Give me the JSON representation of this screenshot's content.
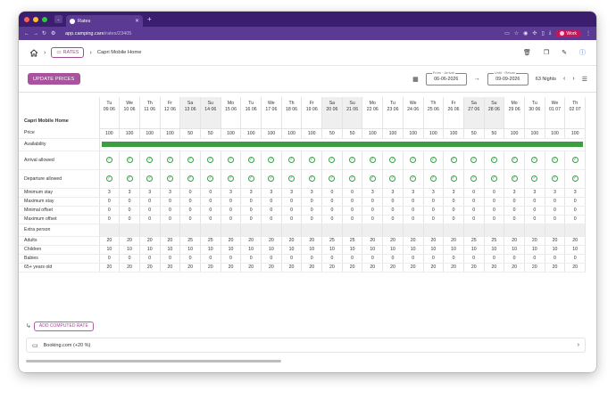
{
  "browser": {
    "tab_title": "Rates",
    "url_host": "app.camping.care",
    "url_path": "/rates/23405",
    "profile_label": "Work"
  },
  "header": {
    "rates_label": "RATES",
    "current": "Capri Mobile Home"
  },
  "toolbar": {
    "update_label": "UPDATE PRICES",
    "from_label": "From · Arrival",
    "from_value": "06-06-2026",
    "until_label": "Until · Return",
    "until_value": "09-09-2026",
    "nights": "63 Nights"
  },
  "grid": {
    "title": "Capri Mobile Home",
    "days": [
      {
        "wd": "Tu",
        "date": "09 06"
      },
      {
        "wd": "We",
        "date": "10 06"
      },
      {
        "wd": "Th",
        "date": "11 06"
      },
      {
        "wd": "Fr",
        "date": "12 06"
      },
      {
        "wd": "Sa",
        "date": "13 06"
      },
      {
        "wd": "Su",
        "date": "14 06"
      },
      {
        "wd": "Mo",
        "date": "15 06"
      },
      {
        "wd": "Tu",
        "date": "16 06"
      },
      {
        "wd": "We",
        "date": "17 06"
      },
      {
        "wd": "Th",
        "date": "18 06"
      },
      {
        "wd": "Fr",
        "date": "19 06"
      },
      {
        "wd": "Sa",
        "date": "20 06"
      },
      {
        "wd": "Su",
        "date": "21 06"
      },
      {
        "wd": "Mo",
        "date": "22 06"
      },
      {
        "wd": "Tu",
        "date": "23 06"
      },
      {
        "wd": "We",
        "date": "24 06"
      },
      {
        "wd": "Th",
        "date": "25 06"
      },
      {
        "wd": "Fr",
        "date": "26 06"
      },
      {
        "wd": "Sa",
        "date": "27 06"
      },
      {
        "wd": "Su",
        "date": "28 06"
      },
      {
        "wd": "Mo",
        "date": "29 06"
      },
      {
        "wd": "Tu",
        "date": "30 06"
      },
      {
        "wd": "We",
        "date": "01 07"
      },
      {
        "wd": "Th",
        "date": "02 07"
      }
    ],
    "rows": [
      {
        "label": "Price",
        "kind": "r12",
        "values": [
          "100",
          "100",
          "100",
          "100",
          "50",
          "50",
          "100",
          "100",
          "100",
          "100",
          "100",
          "50",
          "50",
          "100",
          "100",
          "100",
          "100",
          "100",
          "50",
          "50",
          "100",
          "100",
          "100",
          "100"
        ]
      },
      {
        "label": "Availability",
        "kind": "bar"
      },
      {
        "label": "Arrival allowed",
        "kind": "check"
      },
      {
        "label": "Departure allowed",
        "kind": "check"
      },
      {
        "label": "Minimum stay",
        "kind": "r10",
        "values": [
          "3",
          "3",
          "3",
          "3",
          "0",
          "0",
          "3",
          "3",
          "3",
          "3",
          "3",
          "0",
          "0",
          "3",
          "3",
          "3",
          "3",
          "3",
          "0",
          "0",
          "3",
          "3",
          "3",
          "3"
        ]
      },
      {
        "label": "Maximum stay",
        "kind": "r10",
        "values": [
          "0",
          "0",
          "0",
          "0",
          "0",
          "0",
          "0",
          "0",
          "0",
          "0",
          "0",
          "0",
          "0",
          "0",
          "0",
          "0",
          "0",
          "0",
          "0",
          "0",
          "0",
          "0",
          "0",
          "0"
        ]
      },
      {
        "label": "Minimal offset",
        "kind": "r10",
        "values": [
          "0",
          "0",
          "0",
          "0",
          "0",
          "0",
          "0",
          "0",
          "0",
          "0",
          "0",
          "0",
          "0",
          "0",
          "0",
          "0",
          "0",
          "0",
          "0",
          "0",
          "0",
          "0",
          "0",
          "0"
        ]
      },
      {
        "label": "Maximum offset",
        "kind": "r10",
        "values": [
          "0",
          "0",
          "0",
          "0",
          "0",
          "0",
          "0",
          "0",
          "0",
          "0",
          "0",
          "0",
          "0",
          "0",
          "0",
          "0",
          "0",
          "0",
          "0",
          "0",
          "0",
          "0",
          "0",
          "0"
        ]
      },
      {
        "label": "Extra person",
        "kind": "section"
      },
      {
        "label": "Adults",
        "kind": "r10",
        "values": [
          "20",
          "20",
          "20",
          "20",
          "25",
          "25",
          "20",
          "20",
          "20",
          "20",
          "20",
          "25",
          "25",
          "20",
          "20",
          "20",
          "20",
          "20",
          "25",
          "25",
          "20",
          "20",
          "20",
          "20"
        ]
      },
      {
        "label": "Children",
        "kind": "r10",
        "values": [
          "10",
          "10",
          "10",
          "10",
          "10",
          "10",
          "10",
          "10",
          "10",
          "10",
          "10",
          "10",
          "10",
          "10",
          "10",
          "10",
          "10",
          "10",
          "10",
          "10",
          "10",
          "10",
          "10",
          "10"
        ]
      },
      {
        "label": "Babies",
        "kind": "r10",
        "values": [
          "0",
          "0",
          "0",
          "0",
          "0",
          "0",
          "0",
          "0",
          "0",
          "0",
          "0",
          "0",
          "0",
          "0",
          "0",
          "0",
          "0",
          "0",
          "0",
          "0",
          "0",
          "0",
          "0",
          "0"
        ]
      },
      {
        "label": "65+ years old",
        "kind": "r10",
        "values": [
          "20",
          "20",
          "20",
          "20",
          "20",
          "20",
          "20",
          "20",
          "20",
          "20",
          "20",
          "20",
          "20",
          "20",
          "20",
          "20",
          "20",
          "20",
          "20",
          "20",
          "20",
          "20",
          "20",
          "20"
        ]
      }
    ]
  },
  "footer": {
    "computed_label": "ADD COMPUTED RATE",
    "booking_label": "Booking.com (+20 %)"
  }
}
